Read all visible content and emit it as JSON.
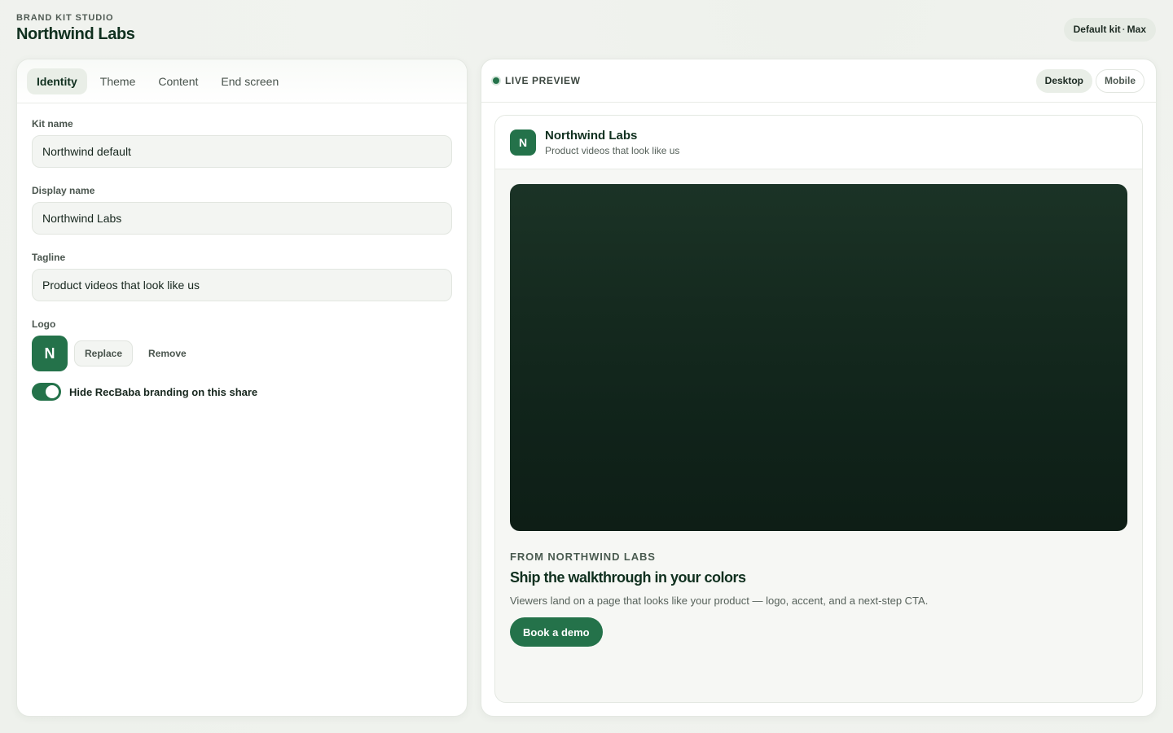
{
  "header": {
    "eyebrow": "BRAND KIT STUDIO",
    "title": "Northwind Labs",
    "kit_badge": {
      "name": "Default kit",
      "separator": "·",
      "plan": "Max"
    }
  },
  "editor": {
    "tabs": [
      {
        "label": "Identity",
        "active": true
      },
      {
        "label": "Theme",
        "active": false
      },
      {
        "label": "Content",
        "active": false
      },
      {
        "label": "End screen",
        "active": false
      }
    ],
    "fields": {
      "kit_name": {
        "label": "Kit name",
        "value": "Northwind default"
      },
      "display_name": {
        "label": "Display name",
        "value": "Northwind Labs"
      },
      "tagline": {
        "label": "Tagline",
        "value": "Product videos that look like us"
      }
    },
    "logo": {
      "label": "Logo",
      "letter": "N",
      "replace_label": "Replace",
      "remove_label": "Remove"
    },
    "branding_toggle": {
      "label": "Hide RecBaba branding on this share",
      "on": true
    }
  },
  "preview": {
    "label": "LIVE PREVIEW",
    "modes": [
      {
        "label": "Desktop",
        "active": true
      },
      {
        "label": "Mobile",
        "active": false
      }
    ],
    "share": {
      "logo_letter": "N",
      "name": "Northwind Labs",
      "tagline": "Product videos that look like us",
      "eyebrow": "FROM NORTHWIND LABS",
      "headline": "Ship the walkthrough in your colors",
      "description": "Viewers land on a page that looks like your product — logo, accent, and a next-step CTA.",
      "cta_label": "Book a demo"
    }
  },
  "colors": {
    "accent": "#24724a",
    "background": "#f1f3ef",
    "video_top": "#1b3326",
    "video_bottom": "#0e1e16",
    "text_primary": "#10301f"
  }
}
